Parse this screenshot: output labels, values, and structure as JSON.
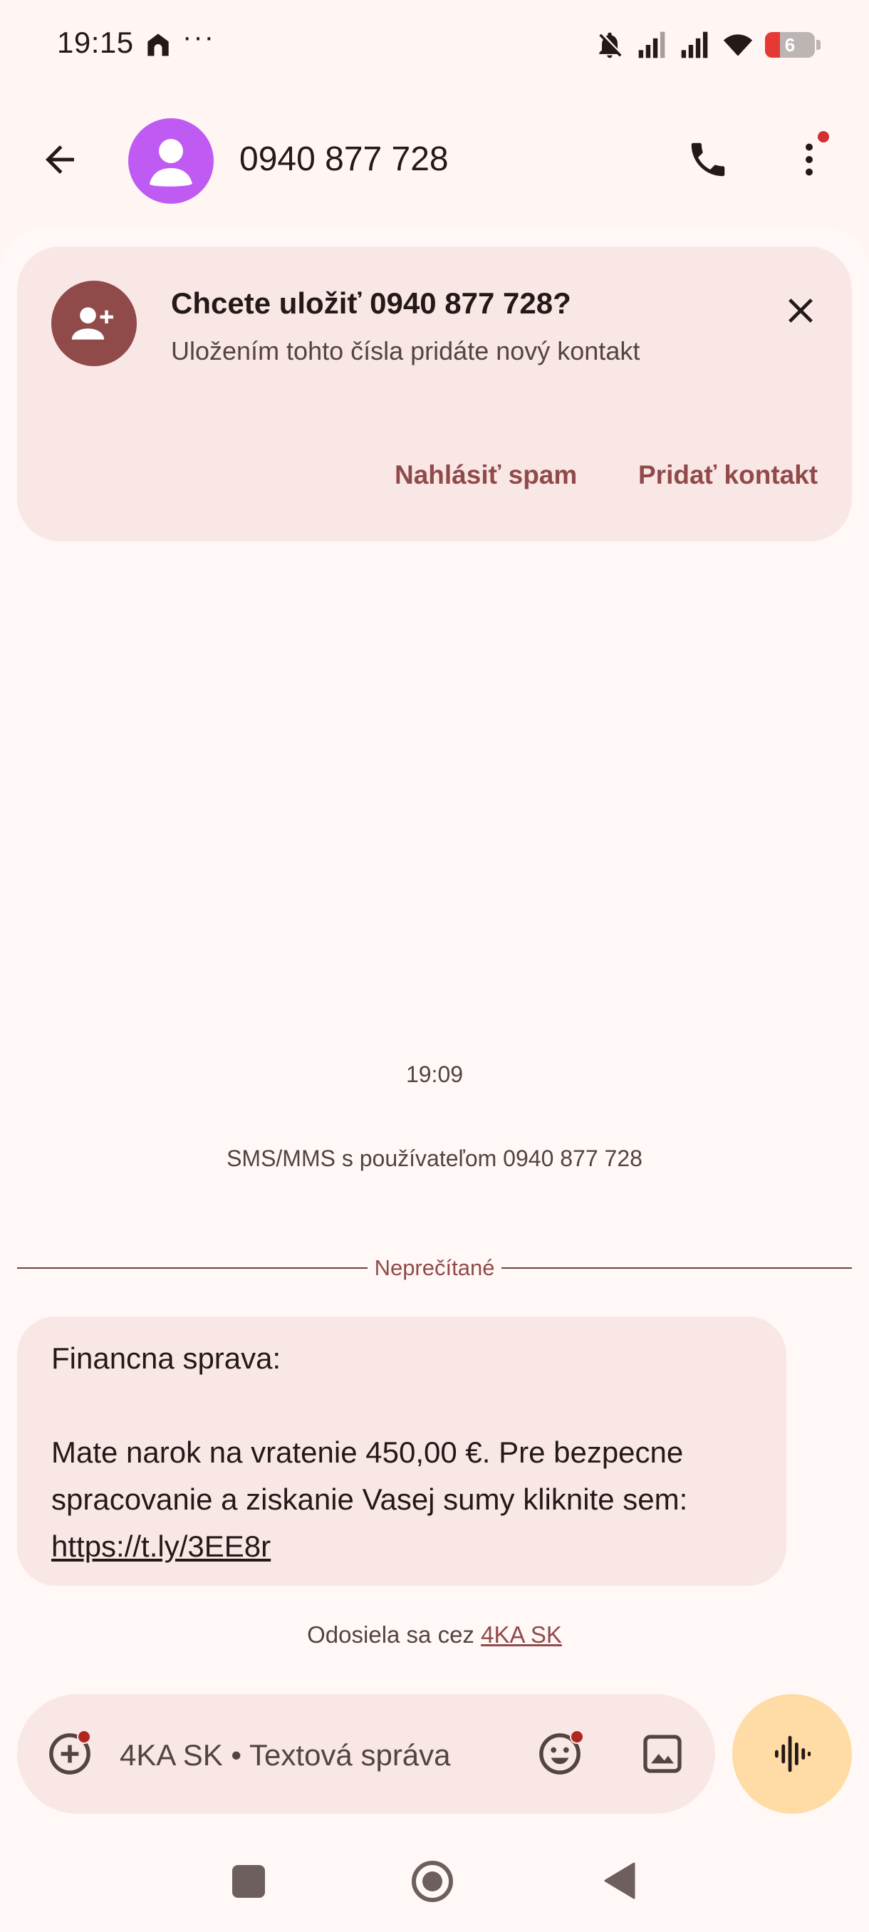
{
  "status_bar": {
    "time": "19:15",
    "more_indicator": "···",
    "battery_level": "6",
    "icons": [
      "home-icon",
      "notifications-off-icon",
      "signal-icon",
      "signal-icon",
      "wifi-icon",
      "battery-low-icon"
    ],
    "battery_color": "#e53935"
  },
  "app_bar": {
    "contact_title": "0940 877 728",
    "avatar_color": "#bf5af2",
    "icons": [
      "back-arrow-icon",
      "person-icon",
      "phone-icon",
      "more-vert-icon"
    ]
  },
  "save_card": {
    "title": "Chcete uložiť 0940 877 728?",
    "subtitle": "Uložením tohto čísla pridáte nový kontakt",
    "report_spam_label": "Nahlásiť spam",
    "add_contact_label": "Pridať kontakt",
    "icons": [
      "person-add-icon",
      "close-icon"
    ]
  },
  "conversation": {
    "time": "19:09",
    "info": "SMS/MMS s používateľom 0940 877 728",
    "unread_label": "Neprečítané",
    "message": {
      "line1": "Financna sprava:",
      "line2": "Mate narok na vratenie 450,00 €. Pre bezpecne spracovanie a ziskanie Vasej sumy kliknite sem:",
      "link": "https://t.ly/3EE8r"
    },
    "sent_via_prefix": "Odosiela sa cez",
    "sent_via_sim": "4KA SK"
  },
  "compose": {
    "placeholder": "4KA SK • Textová správa",
    "icons": [
      "add-circle-icon",
      "emoji-icon",
      "image-icon",
      "voice-wave-icon"
    ],
    "voice_button_color": "#ffdca5"
  },
  "nav_bar": {
    "icons": [
      "recents-square-icon",
      "home-circle-icon",
      "back-triangle-icon"
    ]
  },
  "colors": {
    "background": "#fff5f3",
    "card": "#f9e7e5",
    "accent": "#904a4a",
    "text": "#231918"
  }
}
